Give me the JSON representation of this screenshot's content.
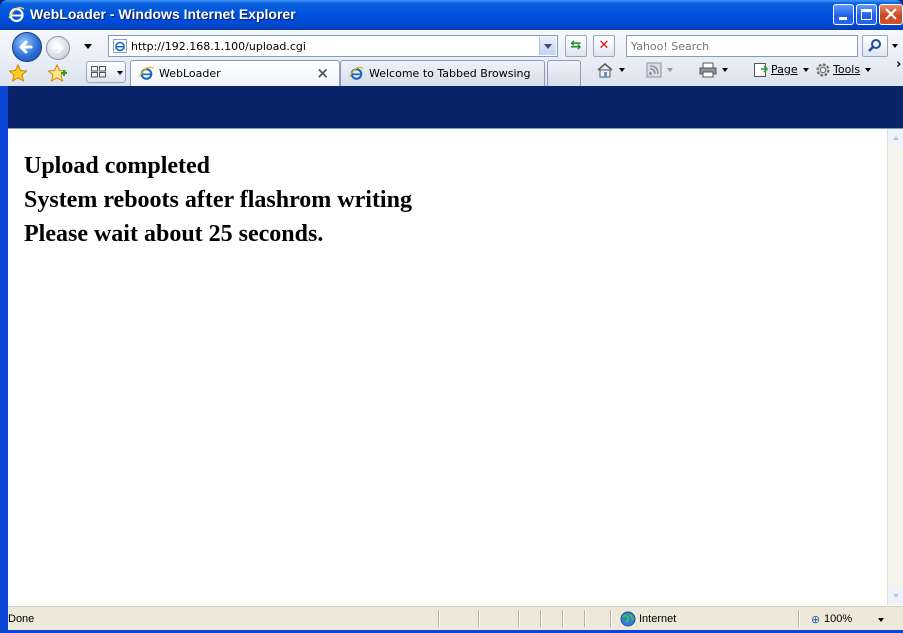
{
  "window": {
    "title": "WebLoader - Windows Internet Explorer"
  },
  "navigation": {
    "address": "http://192.168.1.100/upload.cgi",
    "search_placeholder": "Yahoo! Search"
  },
  "tabs": [
    {
      "label": "WebLoader",
      "active": true
    },
    {
      "label": "Welcome to Tabbed Browsing",
      "active": false
    }
  ],
  "command_bar": {
    "page_label": "Page",
    "tools_label": "Tools"
  },
  "content": {
    "lines": [
      "Upload completed",
      "System reboots after flashrom writing",
      "Please wait about 25 seconds."
    ]
  },
  "status_bar": {
    "status": "Done",
    "zone": "Internet",
    "zoom": "100%"
  },
  "icons": {
    "title": "ie-logo-icon",
    "back": "back-arrow-icon",
    "forward": "forward-arrow-icon",
    "refresh": "refresh-icon",
    "stop": "stop-icon",
    "search": "magnifier-icon",
    "favorites": "favorites-star-icon",
    "add_favorites": "add-favorites-icon",
    "quick_tabs": "quick-tabs-icon",
    "home": "home-icon",
    "feeds": "feeds-icon",
    "print": "printer-icon",
    "page": "page-icon",
    "tools": "gear-icon",
    "zone": "globe-icon",
    "zoom": "zoom-icon"
  },
  "colors": {
    "titlebar": "#0053e1",
    "close_button": "#c8461e",
    "status_bar": "#ece9d8"
  }
}
